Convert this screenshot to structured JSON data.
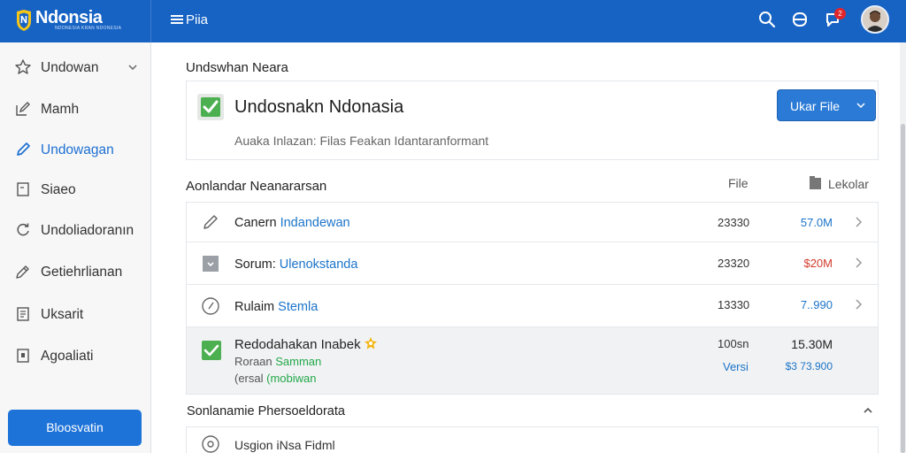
{
  "header": {
    "logo_text": "Ndonsia",
    "logo_subtext": "NDONESIA KRAN NDONESIA",
    "menu_label": "Piia",
    "notification_count": "2",
    "accent_color": "#1763c4"
  },
  "sidebar": {
    "items": [
      {
        "label": "Undowan",
        "icon": "star-icon"
      },
      {
        "label": "Mamh",
        "icon": "edit-square-icon"
      },
      {
        "label": "Undowagan",
        "icon": "pencil-icon"
      },
      {
        "label": "Siaeo",
        "icon": "document-icon"
      },
      {
        "label": "Undoliadoranın",
        "icon": "refresh-icon"
      },
      {
        "label": "Getiehrlianan",
        "icon": "pen-icon"
      },
      {
        "label": "Uksarit",
        "icon": "list-icon"
      },
      {
        "label": "Agoaliati",
        "icon": "page-icon"
      }
    ],
    "button_label": "Bloosvatin"
  },
  "main": {
    "section_title": "Undswhan Neara",
    "card": {
      "title": "Undosnakn Ndonasia",
      "description": "Auaka Inlazan: Filas Feakan Idantaranformant",
      "button_label": "Ukar File"
    },
    "list_title": "Aonlandar Neanararsan",
    "col_file": "File",
    "col_lekolar": "Lekolar",
    "rows": [
      {
        "prefix": "Canern ",
        "link": "Indandewan",
        "count": "23330",
        "size": "57.0M",
        "size_color": "#1b74c9",
        "icon": "pencil-icon"
      },
      {
        "prefix": "Sorum: ",
        "link": "Ulenokstanda",
        "count": "23320",
        "size": "$20M",
        "size_color": "#d23a2a",
        "icon": "file-gray-icon"
      },
      {
        "prefix": "Rulaim ",
        "link": "Stemla",
        "count": "13330",
        "size": "7..990",
        "size_color": "#1b74c9",
        "icon": "clock-icon"
      }
    ],
    "highlight_row": {
      "title": "Redodahakan Inabek",
      "sub1_prefix": "Roraan ",
      "sub1_green": "Samman",
      "sub2_prefix": "(ersal ",
      "sub2_green": "(mobiwan",
      "count": "100sn",
      "versi": "Versi",
      "size": "15.30M",
      "size2": "$3 73.900"
    },
    "bottom_title": "Sonlanamie Phersoeldorata",
    "bottom_row_text": "Usgion iNsa Fidml"
  }
}
